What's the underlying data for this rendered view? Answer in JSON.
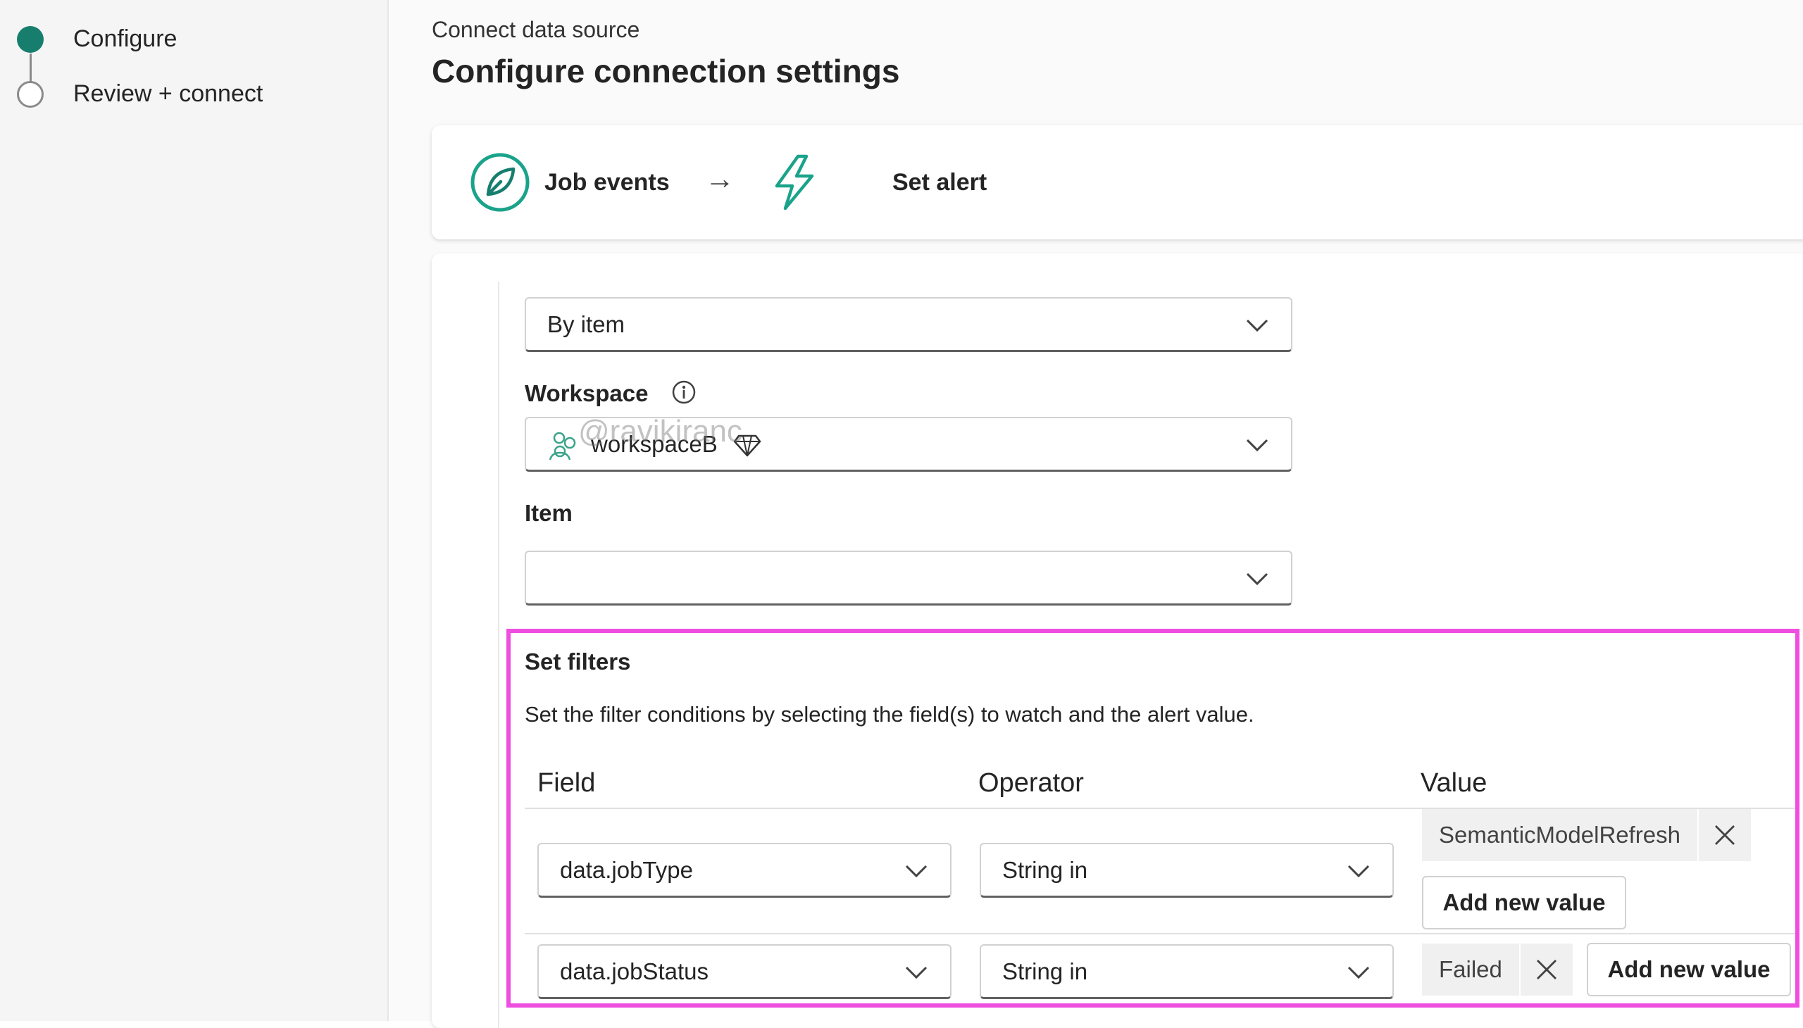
{
  "sidebar": {
    "steps": [
      {
        "label": "Configure",
        "state": "current"
      },
      {
        "label": "Review + connect",
        "state": "pending"
      }
    ]
  },
  "header": {
    "breadcrumb": "Connect data source",
    "title": "Configure connection settings"
  },
  "flow": {
    "source_label": "Job events",
    "target_label": "Set alert"
  },
  "form": {
    "scope_value": "By item",
    "workspace_label": "Workspace",
    "workspace_value": "workspaceB",
    "watermark": "@ravikiranс",
    "item_label": "Item",
    "item_value": ""
  },
  "filters": {
    "title": "Set filters",
    "description": "Set the filter conditions by selecting the field(s) to watch and the alert value.",
    "columns": {
      "field": "Field",
      "operator": "Operator",
      "value": "Value"
    },
    "rows": [
      {
        "field": "data.jobType",
        "operator": "String in",
        "values": [
          "SemanticModelRefresh"
        ],
        "add_label": "Add new value"
      },
      {
        "field": "data.jobStatus",
        "operator": "String in",
        "values": [
          "Failed"
        ],
        "add_label": "Add new value"
      }
    ]
  },
  "colors": {
    "accent": "#177e6d",
    "highlight": "#ee4fe0"
  }
}
